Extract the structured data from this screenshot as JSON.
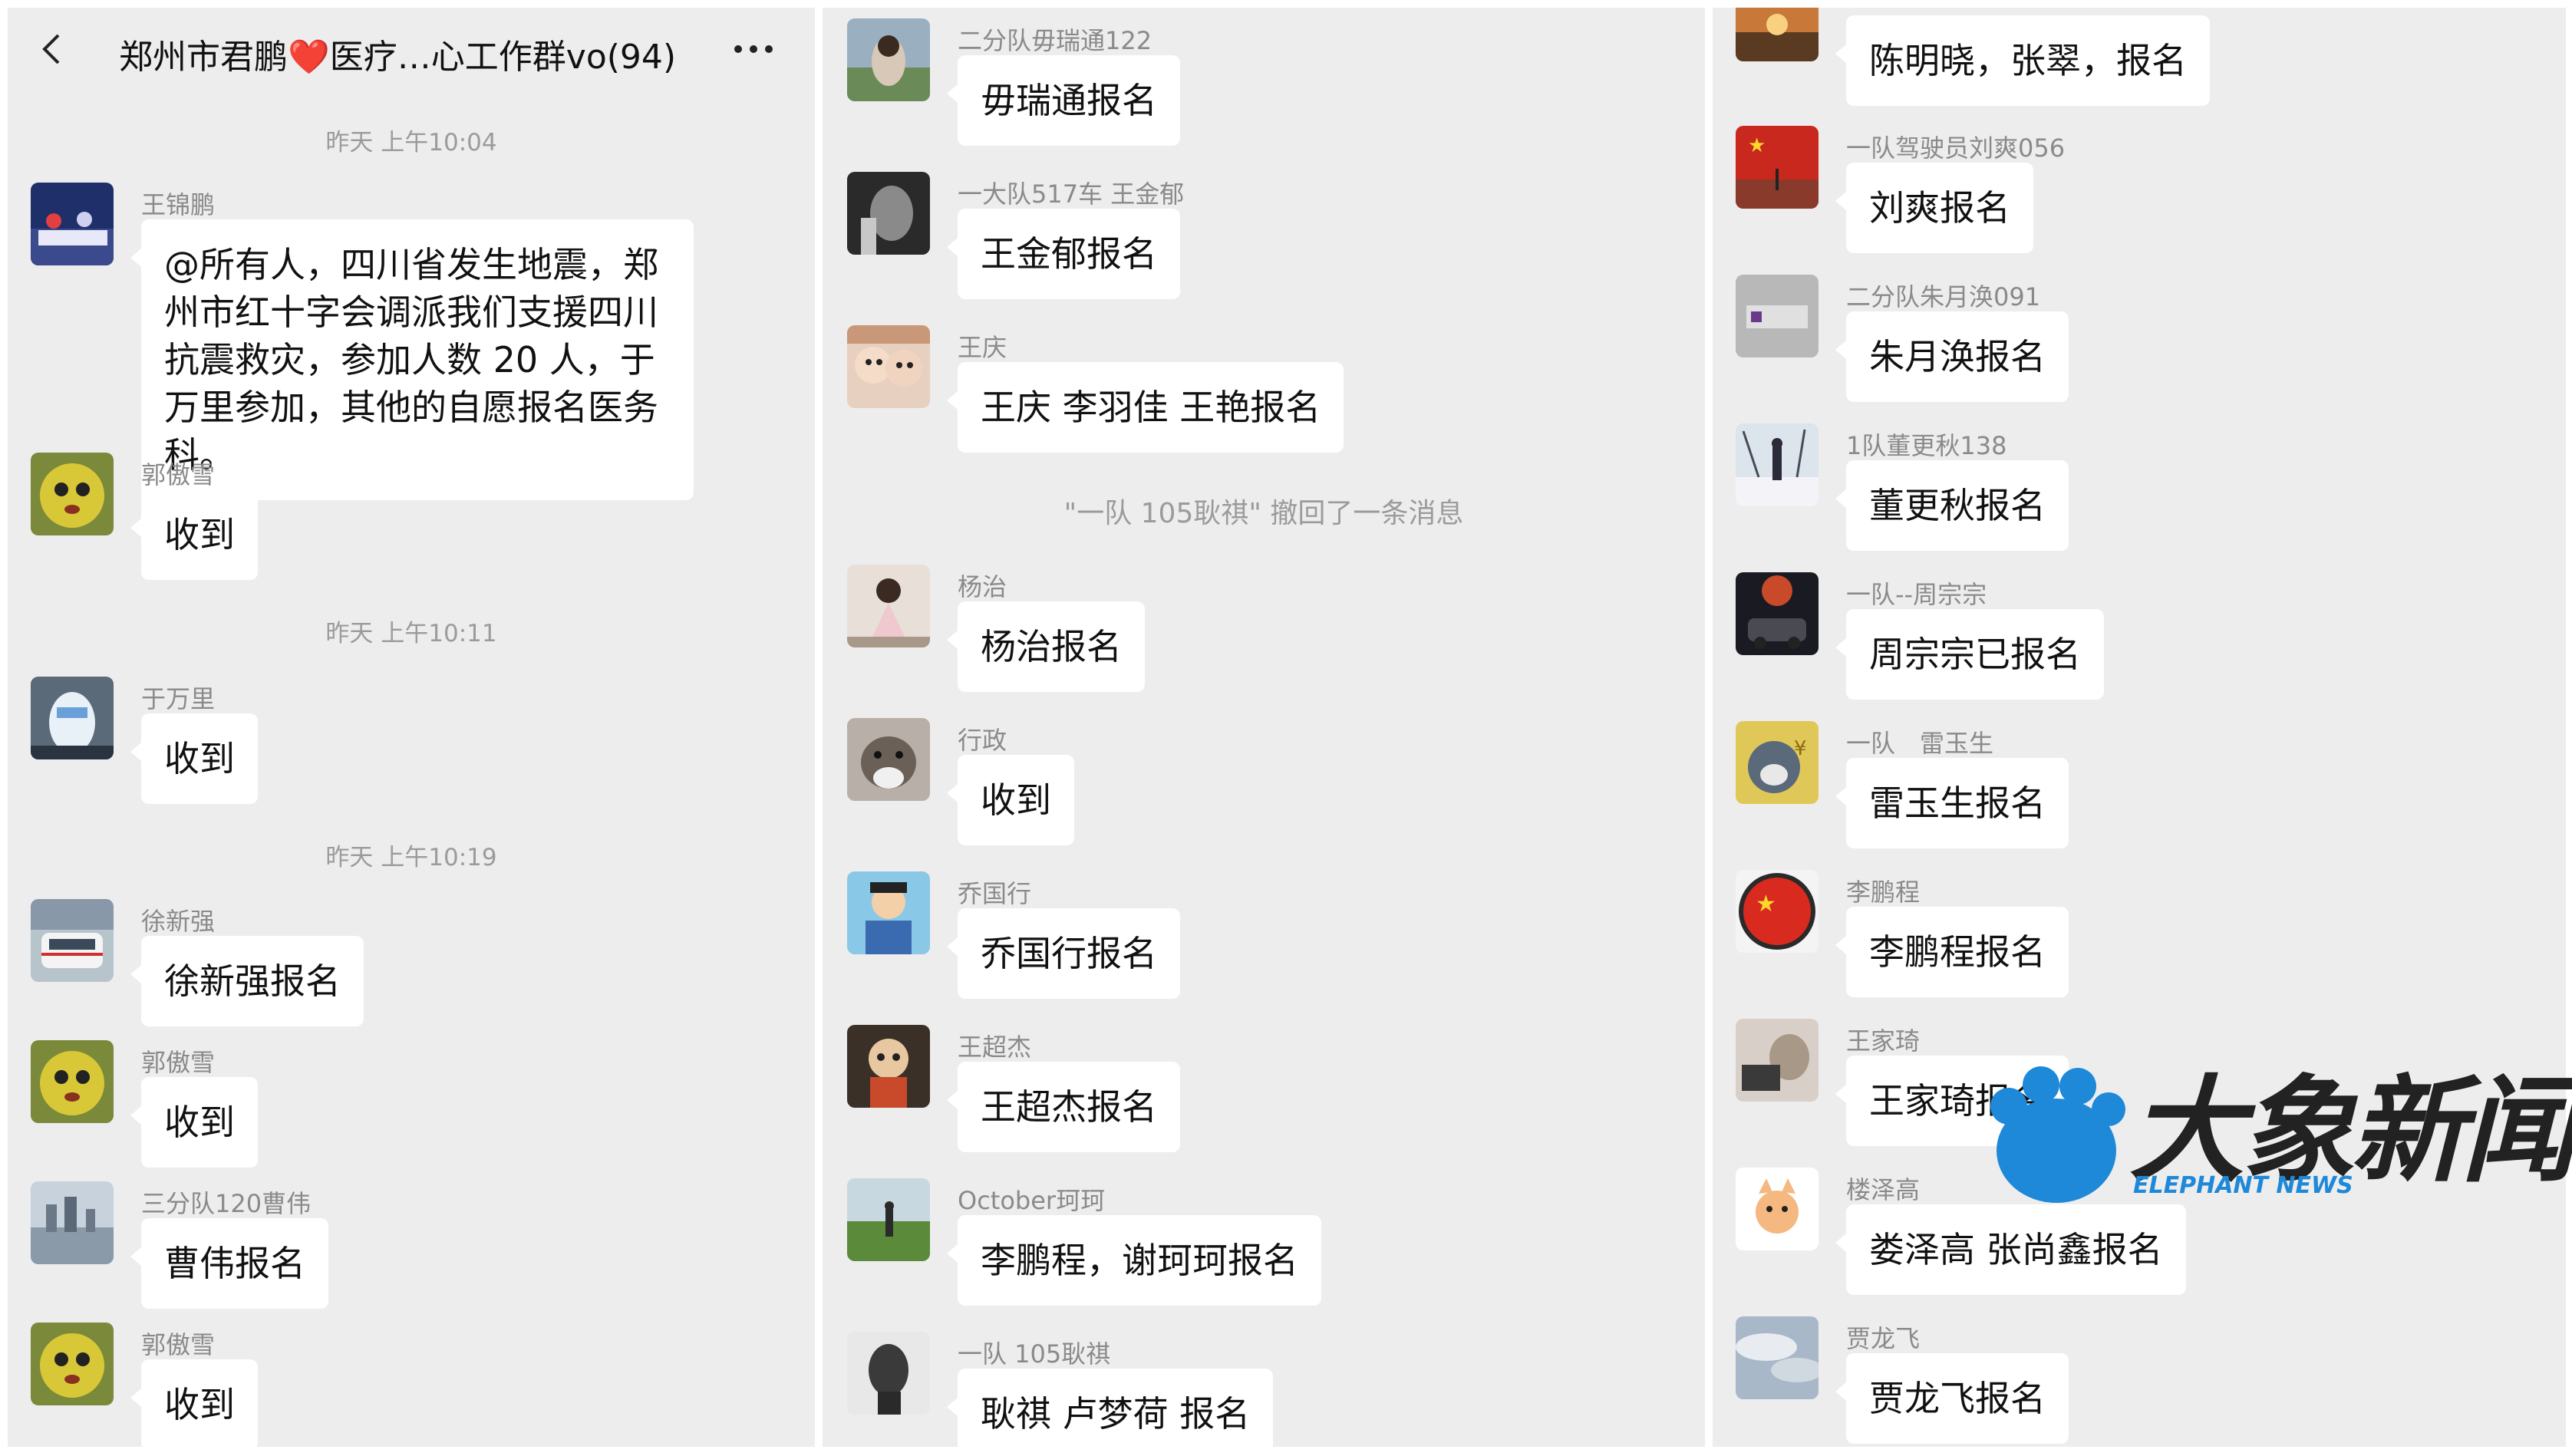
{
  "header": {
    "title": "郑州市君鹏❤️医疗…心工作群vo(94)"
  },
  "panel1": {
    "time1": "昨天 上午10:04",
    "m1": {
      "sender": "王锦鹏",
      "text": "@所有人，四川省发生地震，郑州市红十字会调派我们支援四川抗震救灾，参加人数 20 人，于万里参加，其他的自愿报名医务科。"
    },
    "m2": {
      "sender": "郭傲雪",
      "text": "收到"
    },
    "time2": "昨天 上午10:11",
    "m3": {
      "sender": "于万里",
      "text": "收到"
    },
    "time3": "昨天 上午10:19",
    "m4": {
      "sender": "徐新强",
      "text": "徐新强报名"
    },
    "m5": {
      "sender": "郭傲雪",
      "text": "收到"
    },
    "m6": {
      "sender": "三分队120曹伟",
      "text": "曹伟报名"
    },
    "m7": {
      "sender": "郭傲雪",
      "text": "收到"
    }
  },
  "panel2": {
    "m1": {
      "sender": "二分队毋瑞通122",
      "text": "毋瑞通报名"
    },
    "m2": {
      "sender": "一大队517车 王金郁",
      "text": "王金郁报名"
    },
    "m3": {
      "sender": "王庆",
      "text": "王庆 李羽佳 王艳报名"
    },
    "recall": "\"一队 105耿祺\" 撤回了一条消息",
    "m4": {
      "sender": "杨治",
      "text": "杨治报名"
    },
    "m5": {
      "sender": "行政",
      "text": "收到"
    },
    "m6": {
      "sender": "乔国行",
      "text": "乔国行报名"
    },
    "m7": {
      "sender": "王超杰",
      "text": "王超杰报名"
    },
    "m8": {
      "sender": "October珂珂",
      "text": "李鹏程，谢珂珂报名"
    },
    "m9": {
      "sender": "一队 105耿祺",
      "text": "耿祺 卢梦荷 报名"
    }
  },
  "panel3": {
    "m1": {
      "sender": "",
      "text": "陈明晓，张翠，报名"
    },
    "m2": {
      "sender": "一队驾驶员刘爽056",
      "text": "刘爽报名"
    },
    "m3": {
      "sender": "二分队朱月涣091",
      "text": "朱月涣报名"
    },
    "m4": {
      "sender": "1队董更秋138",
      "text": "董更秋报名"
    },
    "m5": {
      "sender": "一队--周宗宗",
      "text": "周宗宗已报名"
    },
    "m6": {
      "sender": "一队　雷玉生",
      "text": "雷玉生报名"
    },
    "m7": {
      "sender": "李鹏程",
      "text": "李鹏程报名"
    },
    "m8": {
      "sender": "王家琦",
      "text": "王家琦报名"
    },
    "m9": {
      "sender": "楼泽高",
      "text": "娄泽高  张尚鑫报名"
    },
    "m10": {
      "sender": "贾龙飞",
      "text": "贾龙飞报名"
    }
  },
  "watermark": {
    "cn": "大象新闻",
    "en": "ELEPHANT NEWS"
  }
}
